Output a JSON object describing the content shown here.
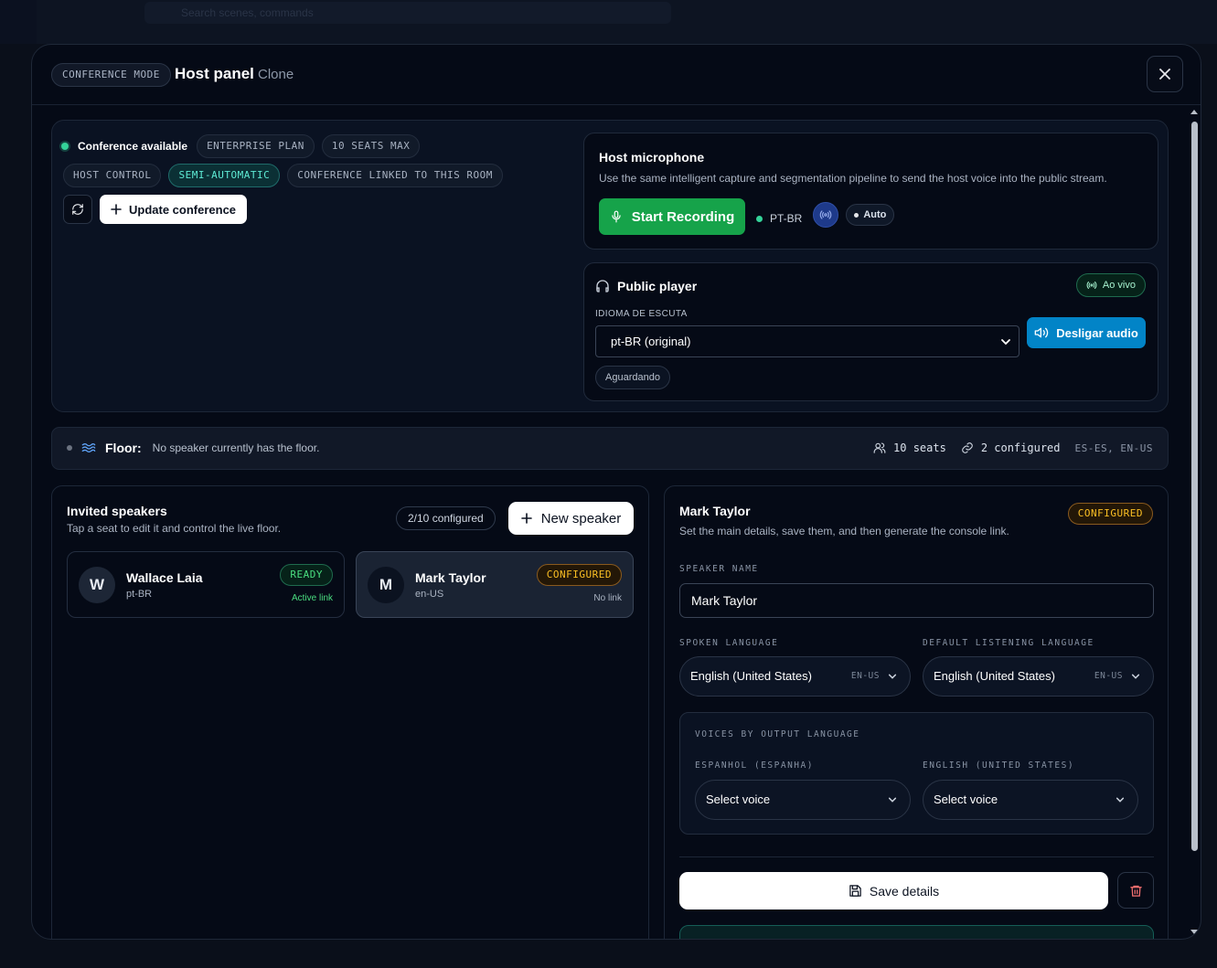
{
  "background": {
    "search_placeholder": "Search scenes, commands"
  },
  "header": {
    "mode_badge": "CONFERENCE MODE",
    "title": "Host panel",
    "subtitle": "Clone",
    "close_icon": "close-icon"
  },
  "conference": {
    "status": "Conference available",
    "plan_tag": "ENTERPRISE PLAN",
    "seats_tag": "10 SEATS MAX",
    "host_control_tag": "HOST CONTROL",
    "semi_auto_tag": "SEMI-AUTOMATIC",
    "linked_tag": "CONFERENCE LINKED TO THIS ROOM",
    "refresh_icon": "refresh-icon",
    "update_label": "Update conference"
  },
  "mic": {
    "title": "Host microphone",
    "description": "Use the same intelligent capture and segmentation pipeline to send the host voice into the public stream.",
    "record_label": "Start Recording",
    "lang_code": "PT-BR",
    "auto_label": "Auto"
  },
  "player": {
    "title": "Public player",
    "live_label": "Ao vivo",
    "listen_label": "IDIOMA DE ESCUTA",
    "selected_language": "pt-BR (original)",
    "audio_button": "Desligar audio",
    "waiting": "Aguardando"
  },
  "floor": {
    "label": "Floor:",
    "text": "No speaker currently has the floor.",
    "seats": "10 seats",
    "configured": "2 configured",
    "languages": "ES-ES, EN-US"
  },
  "speakers": {
    "title": "Invited speakers",
    "description": "Tap a seat to edit it and control the live floor.",
    "count": "2/10 configured",
    "new_label": "New speaker",
    "items": [
      {
        "initial": "W",
        "name": "Wallace Laia",
        "lang": "pt-BR",
        "badge": "READY",
        "link": "Active link"
      },
      {
        "initial": "M",
        "name": "Mark Taylor",
        "lang": "en-US",
        "badge": "CONFIGURED",
        "link": "No link"
      }
    ]
  },
  "details": {
    "title": "Mark Taylor",
    "description": "Set the main details, save them, and then generate the console link.",
    "badge": "CONFIGURED",
    "name_label": "SPEAKER NAME",
    "name_value": "Mark Taylor",
    "spoken_label": "SPOKEN LANGUAGE",
    "spoken_value": "English (United States)",
    "spoken_code": "EN-US",
    "listening_label": "DEFAULT LISTENING LANGUAGE",
    "listening_value": "English (United States)",
    "listening_code": "EN-US",
    "voices_label": "VOICES BY OUTPUT LANGUAGE",
    "voice_es_label": "ESPANHOL (ESPANHA)",
    "voice_es_value": "Select voice",
    "voice_en_label": "ENGLISH (UNITED STATES)",
    "voice_en_value": "Select voice",
    "save_label": "Save details"
  },
  "colors": {
    "accent_green": "#16a34a",
    "accent_blue": "#0284c7",
    "status_amber": "#fbbf24",
    "status_teal": "#5eead4"
  }
}
